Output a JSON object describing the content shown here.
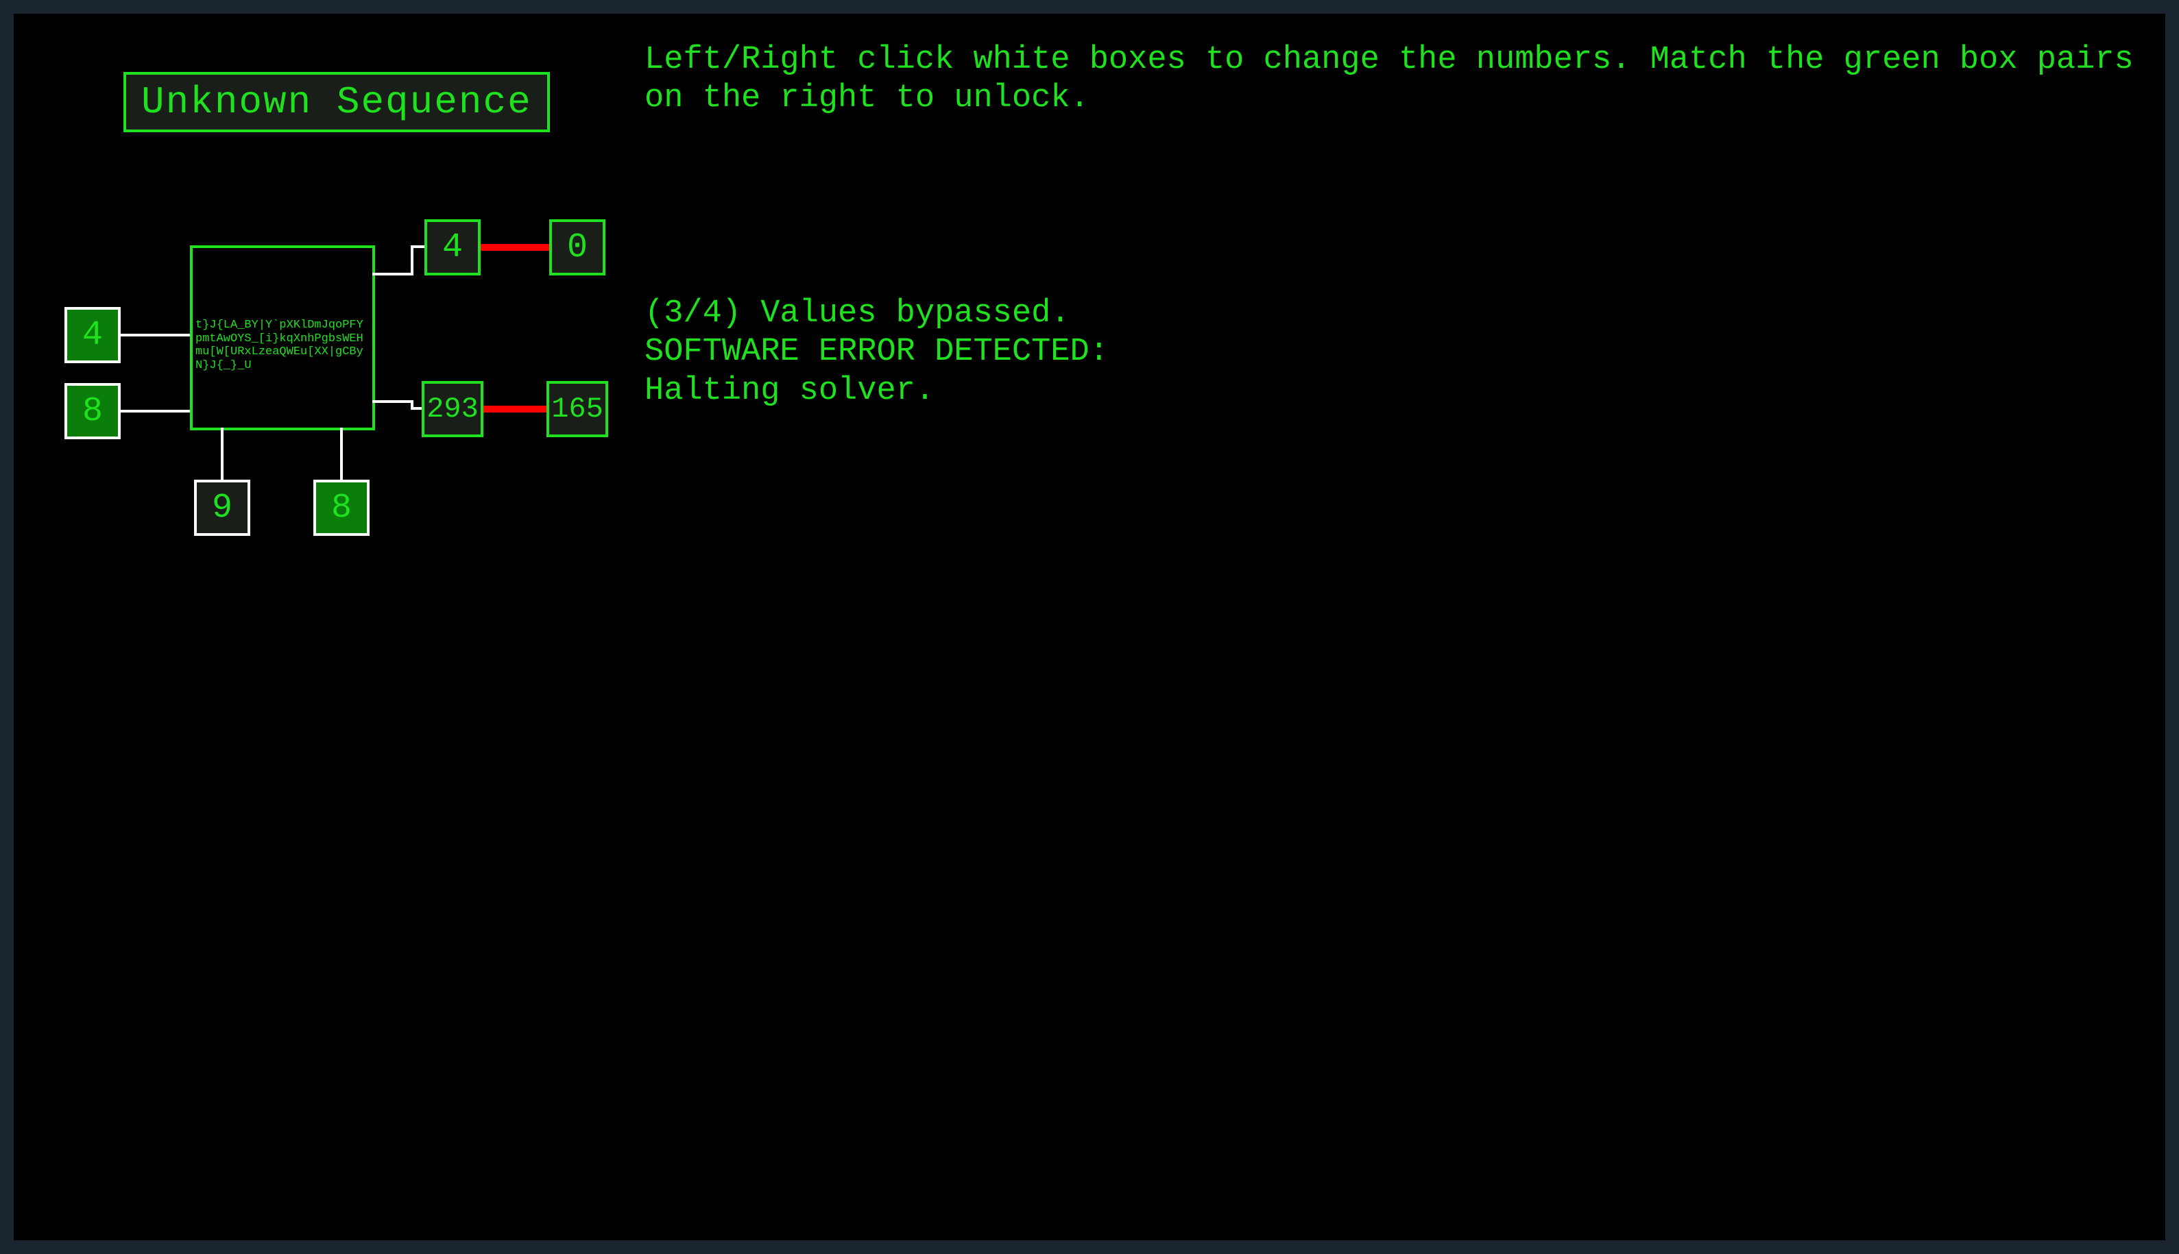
{
  "title": "Unknown Sequence",
  "instructions": "Left/Right click white boxes to change the numbers. Match the green box pairs on the right to unlock.",
  "status": "(3/4) Values bypassed.\nSOFTWARE ERROR DETECTED:\nHalting solver.",
  "chip_garbage": "t}J{LA_BY|Y`pXKlDmJqoPFYpmtAwOYS_[i}kqXnhPgbsWEHmu[W[URxLzeaQWEu[XX|gCByN}J{_}_U",
  "inputs": {
    "left_top": "4",
    "left_bottom": "8",
    "bottom_left": "9",
    "bottom_right": "8"
  },
  "outputs": {
    "row1_left": "4",
    "row1_right": "0",
    "row2_left": "293",
    "row2_right": "165"
  },
  "colors": {
    "accent": "#1fe11f",
    "mismatch": "#ff0000",
    "wire": "#ffffff",
    "bg_panel": "#191e19",
    "bg_match": "#0a7d0a"
  }
}
